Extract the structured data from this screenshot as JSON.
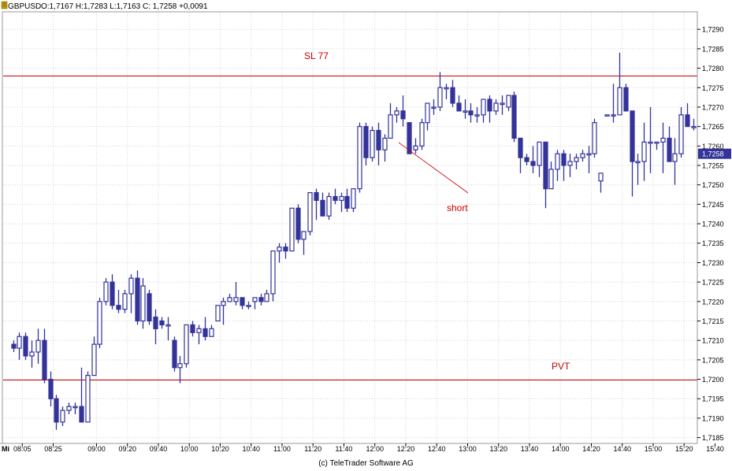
{
  "header": {
    "symbol": "GBPUSD",
    "ohlc": "O:1,7167 H:1,7283 L:1,7163 C: 1,7258 +0,0091"
  },
  "day_label": "Mi",
  "footer": "(c) TeleTrader Software AG",
  "colors": {
    "candle": "#333399",
    "level_line": "#cc0000",
    "grid": "#d4d4d4",
    "price_box": "#333399"
  },
  "annotations": {
    "sl": "SL 77",
    "pvt": "PVT",
    "short": "short"
  },
  "chart_data": {
    "type": "candlestick",
    "title": "",
    "xlabel": "",
    "ylabel": "",
    "ylim": [
      1.71835,
      1.72945
    ],
    "y_ticks": [
      "1,7185",
      "1,7190",
      "1,7195",
      "1,7200",
      "1,7205",
      "1,7210",
      "1,7215",
      "1,7220",
      "1,7225",
      "1,7230",
      "1,7235",
      "1,7240",
      "1,7245",
      "1,7250",
      "1,7255",
      "1,7260",
      "1,7265",
      "1,7270",
      "1,7275",
      "1,7280",
      "1,7285",
      "1,7290"
    ],
    "y_tick_values": [
      1.7185,
      1.719,
      1.7195,
      1.72,
      1.7205,
      1.721,
      1.7215,
      1.722,
      1.7225,
      1.723,
      1.7235,
      1.724,
      1.7245,
      1.725,
      1.7255,
      1.726,
      1.7265,
      1.727,
      1.7275,
      1.728,
      1.7285,
      1.729
    ],
    "x_ticks": [
      "08:05",
      "08:25",
      "09:00",
      "09:20",
      "09:40",
      "10:00",
      "10:20",
      "10:40",
      "11:00",
      "11:20",
      "11:40",
      "12:00",
      "12:20",
      "12:40",
      "13:00",
      "13:20",
      "13:40",
      "14:00",
      "14:20",
      "14:40",
      "15:00",
      "15:20",
      "15:40"
    ],
    "x_tick_bars": [
      1.5,
      6.5,
      13.5,
      18.5,
      23.5,
      28.5,
      33.5,
      38.5,
      43.5,
      48.5,
      53.5,
      58.5,
      63.5,
      68.5,
      73.5,
      78.5,
      83.5,
      88.5,
      93.5,
      98.5,
      103.5,
      108.5,
      113.5
    ],
    "last_price": "1,7258",
    "last_value": 1.7258,
    "levels": [
      {
        "label": "SL 77",
        "value": 1.7278
      },
      {
        "label": "PVT",
        "value": 1.72
      }
    ],
    "candles": [
      [
        1.7209,
        1.721,
        1.7207,
        1.7208
      ],
      [
        1.7208,
        1.7212,
        1.7205,
        1.7211
      ],
      [
        1.7211,
        1.7212,
        1.7205,
        1.7206
      ],
      [
        1.7206,
        1.721,
        1.7203,
        1.7207
      ],
      [
        1.7207,
        1.7213,
        1.7204,
        1.721
      ],
      [
        1.721,
        1.7213,
        1.7199,
        1.72
      ],
      [
        1.72,
        1.7202,
        1.7193,
        1.7195
      ],
      [
        1.7195,
        1.7196,
        1.7187,
        1.7189
      ],
      [
        1.7189,
        1.7193,
        1.7188,
        1.7192
      ],
      [
        1.7192,
        1.7194,
        1.7191,
        1.7193
      ],
      [
        1.7193,
        1.7194,
        1.7191,
        1.7193
      ],
      [
        1.7193,
        1.7203,
        1.7189,
        1.7189
      ],
      [
        1.7189,
        1.7202,
        1.7189,
        1.7201
      ],
      [
        1.7201,
        1.7211,
        1.7201,
        1.7209
      ],
      [
        1.7209,
        1.7221,
        1.7208,
        1.722
      ],
      [
        1.722,
        1.7226,
        1.7219,
        1.7225
      ],
      [
        1.7225,
        1.7227,
        1.7218,
        1.7219
      ],
      [
        1.7219,
        1.7223,
        1.7217,
        1.7218
      ],
      [
        1.7218,
        1.7223,
        1.7217,
        1.7222
      ],
      [
        1.7222,
        1.7227,
        1.7217,
        1.7226
      ],
      [
        1.7226,
        1.7228,
        1.7214,
        1.7215
      ],
      [
        1.7215,
        1.7226,
        1.7213,
        1.7224
      ],
      [
        1.7222,
        1.7223,
        1.7214,
        1.7215
      ],
      [
        1.7216,
        1.7218,
        1.7209,
        1.7213
      ],
      [
        1.7215,
        1.7216,
        1.7213,
        1.7214
      ],
      [
        1.7214,
        1.7216,
        1.721,
        1.7214
      ],
      [
        1.721,
        1.7211,
        1.7202,
        1.7203
      ],
      [
        1.7203,
        1.7206,
        1.7199,
        1.7204
      ],
      [
        1.7204,
        1.7214,
        1.7203,
        1.7214
      ],
      [
        1.7214,
        1.7215,
        1.7211,
        1.7212
      ],
      [
        1.7212,
        1.7214,
        1.7209,
        1.7213
      ],
      [
        1.7213,
        1.7216,
        1.721,
        1.7211
      ],
      [
        1.7211,
        1.7214,
        1.7211,
        1.7213
      ],
      [
        1.7215,
        1.7219,
        1.7215,
        1.7219
      ],
      [
        1.7219,
        1.7221,
        1.7214,
        1.722
      ],
      [
        1.722,
        1.7222,
        1.722,
        1.7221
      ],
      [
        1.722,
        1.7225,
        1.7219,
        1.7221
      ],
      [
        1.7221,
        1.7221,
        1.7218,
        1.7219
      ],
      [
        1.7219,
        1.722,
        1.7218,
        1.7219
      ],
      [
        1.722,
        1.7221,
        1.7218,
        1.7221
      ],
      [
        1.7221,
        1.7222,
        1.7219,
        1.722
      ],
      [
        1.722,
        1.7223,
        1.722,
        1.7222
      ],
      [
        1.7222,
        1.7233,
        1.722,
        1.7233
      ],
      [
        1.7233,
        1.7235,
        1.723,
        1.7234
      ],
      [
        1.7234,
        1.7235,
        1.7231,
        1.7233
      ],
      [
        1.7233,
        1.7244,
        1.7233,
        1.7244
      ],
      [
        1.7244,
        1.7245,
        1.7235,
        1.7236
      ],
      [
        1.7236,
        1.7238,
        1.7232,
        1.7238
      ],
      [
        1.7238,
        1.7248,
        1.7237,
        1.7248
      ],
      [
        1.7248,
        1.7249,
        1.7241,
        1.7246
      ],
      [
        1.7246,
        1.7248,
        1.7242,
        1.7242
      ],
      [
        1.7242,
        1.7248,
        1.7241,
        1.7247
      ],
      [
        1.7247,
        1.7249,
        1.7245,
        1.7246
      ],
      [
        1.7246,
        1.7248,
        1.7243,
        1.7247
      ],
      [
        1.7247,
        1.7249,
        1.7243,
        1.7244
      ],
      [
        1.7244,
        1.7249,
        1.7243,
        1.7249
      ],
      [
        1.7249,
        1.7266,
        1.7248,
        1.7265
      ],
      [
        1.7265,
        1.7266,
        1.7255,
        1.7257
      ],
      [
        1.7257,
        1.7265,
        1.7256,
        1.7264
      ],
      [
        1.7264,
        1.7266,
        1.7255,
        1.7259
      ],
      [
        1.7259,
        1.7263,
        1.7256,
        1.7262
      ],
      [
        1.7262,
        1.7271,
        1.7262,
        1.7268
      ],
      [
        1.7268,
        1.727,
        1.7266,
        1.7269
      ],
      [
        1.7269,
        1.7273,
        1.7265,
        1.7267
      ],
      [
        1.7266,
        1.7266,
        1.7258,
        1.7258
      ],
      [
        1.7259,
        1.7262,
        1.7258,
        1.726
      ],
      [
        1.726,
        1.7267,
        1.7259,
        1.7266
      ],
      [
        1.7266,
        1.7271,
        1.7264,
        1.7271
      ],
      [
        1.727,
        1.7272,
        1.7268,
        1.727
      ],
      [
        1.727,
        1.7279,
        1.7269,
        1.7275
      ],
      [
        1.7275,
        1.7276,
        1.7272,
        1.7275
      ],
      [
        1.7275,
        1.7277,
        1.727,
        1.7271
      ],
      [
        1.7271,
        1.7273,
        1.7269,
        1.7269
      ],
      [
        1.7269,
        1.7272,
        1.7267,
        1.7269
      ],
      [
        1.7269,
        1.7271,
        1.7266,
        1.7268
      ],
      [
        1.7268,
        1.727,
        1.7266,
        1.7268
      ],
      [
        1.7268,
        1.7272,
        1.7266,
        1.7272
      ],
      [
        1.7272,
        1.7273,
        1.7266,
        1.7269
      ],
      [
        1.7269,
        1.7272,
        1.7268,
        1.7271
      ],
      [
        1.7271,
        1.7273,
        1.7268,
        1.7271
      ],
      [
        1.727,
        1.7273,
        1.7269,
        1.7273
      ],
      [
        1.7273,
        1.7274,
        1.7261,
        1.7262
      ],
      [
        1.7262,
        1.7262,
        1.7253,
        1.7257
      ],
      [
        1.7257,
        1.7258,
        1.7255,
        1.7256
      ],
      [
        1.7256,
        1.726,
        1.7253,
        1.7255
      ],
      [
        1.7255,
        1.7261,
        1.7252,
        1.7261
      ],
      [
        1.7261,
        1.7261,
        1.7244,
        1.7249
      ],
      [
        1.7249,
        1.7256,
        1.7252,
        1.7254
      ],
      [
        1.7254,
        1.7259,
        1.7251,
        1.7258
      ],
      [
        1.7258,
        1.7259,
        1.7251,
        1.7255
      ],
      [
        1.7255,
        1.7258,
        1.7252,
        1.7256
      ],
      [
        1.7256,
        1.7258,
        1.7254,
        1.7257
      ],
      [
        1.7257,
        1.7259,
        1.7256,
        1.7258
      ],
      [
        1.7258,
        1.726,
        1.7253,
        1.7258
      ],
      [
        1.7258,
        1.7267,
        1.7257,
        1.7266
      ],
      [
        1.7251,
        1.7253,
        1.7248,
        1.7253
      ],
      [
        1.7268,
        1.7268,
        1.7268,
        1.7268
      ],
      [
        1.7268,
        1.7276,
        1.7266,
        1.7268
      ],
      [
        1.7268,
        1.7284,
        1.7268,
        1.7275
      ],
      [
        1.7275,
        1.7276,
        1.7269,
        1.7269
      ],
      [
        1.7269,
        1.7269,
        1.7247,
        1.7256
      ],
      [
        1.7256,
        1.7258,
        1.725,
        1.7256
      ],
      [
        1.7256,
        1.7266,
        1.7251,
        1.7261
      ],
      [
        1.7261,
        1.727,
        1.7253,
        1.7261
      ],
      [
        1.7261,
        1.7261,
        1.7259,
        1.7261
      ],
      [
        1.7261,
        1.7266,
        1.7253,
        1.7262
      ],
      [
        1.7262,
        1.7265,
        1.7256,
        1.7256
      ],
      [
        1.7256,
        1.7262,
        1.725,
        1.7258
      ],
      [
        1.7258,
        1.727,
        1.7257,
        1.7268
      ],
      [
        1.7268,
        1.7271,
        1.7265,
        1.7265
      ],
      [
        1.7265,
        1.7267,
        1.7264,
        1.7265
      ],
      [
        1.7265,
        1.7266,
        1.7258,
        1.7258
      ]
    ]
  }
}
